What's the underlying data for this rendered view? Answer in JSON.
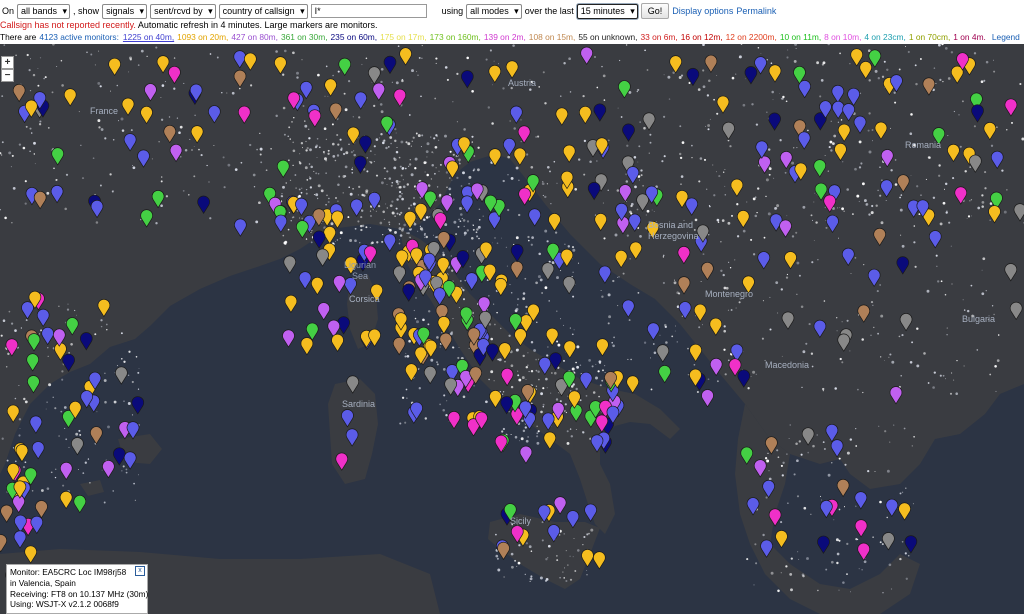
{
  "toolbar": {
    "on_label": "On",
    "bands_value": "all bands",
    "show_label": ", show",
    "signals_value": "signals",
    "sentrcvd_value": "sent/rcvd by",
    "country_value": "country of callsign",
    "callsign_value": "I*",
    "using_label": "using",
    "modes_value": "all modes",
    "over_label": "over the last",
    "time_value": "15 minutes",
    "go_label": "Go!",
    "display_options_label": "Display options",
    "permalink_label": "Permalink"
  },
  "warning": {
    "callsign_not_reported": "Callsign has not reported recently.",
    "refresh_text": "Automatic refresh in 4 minutes. Large markers are monitors."
  },
  "stats": {
    "prefix": "There are",
    "monitors_count": "4123 active monitors:",
    "bands": [
      {
        "text": "1225 on 40m,",
        "color": "#4040d0",
        "underline": true
      },
      {
        "text": "1093 on 20m,",
        "color": "#e2a400"
      },
      {
        "text": "427 on 80m,",
        "color": "#9a50d0"
      },
      {
        "text": "361 on 30m,",
        "color": "#3aa83a"
      },
      {
        "text": "235 on 60m,",
        "color": "#0a0a80"
      },
      {
        "text": "175 on 17m,",
        "color": "#e6e050"
      },
      {
        "text": "173 on 160m,",
        "color": "#70c020"
      },
      {
        "text": "139 on 2m,",
        "color": "#d03ad0"
      },
      {
        "text": "108 on 15m,",
        "color": "#c08850"
      },
      {
        "text": "55 on unknown,",
        "color": "#222222"
      },
      {
        "text": "33 on 6m,",
        "color": "#d02020"
      },
      {
        "text": "16 on 12m,",
        "color": "#c00000"
      },
      {
        "text": "12 on 2200m,",
        "color": "#e04020"
      },
      {
        "text": "10 on 11m,",
        "color": "#20c020"
      },
      {
        "text": "8 on 10m,",
        "color": "#e050e0"
      },
      {
        "text": "4 on 23cm,",
        "color": "#20a0b0"
      },
      {
        "text": "1 on 70cm,",
        "color": "#90a000"
      },
      {
        "text": "1 on 4m.",
        "color": "#a00050"
      }
    ],
    "legend_label": "Legend"
  },
  "map": {
    "zoom_in": "+",
    "zoom_out": "−",
    "places": [
      "France",
      "Austria",
      "Romania",
      "Ligurian Sea",
      "Bosnia and Herzegovina",
      "Montenegro",
      "Macedonia",
      "Bulgaria",
      "Sicily",
      "Sardinia",
      "Corsica"
    ]
  },
  "popup": {
    "line1": "Monitor: EA5CRC Loc IM98rj58",
    "line2": "in Valencia, Spain",
    "line3": "Receiving: FT8 on 10.137 MHz (30m)",
    "line4": "Using: WSJT-X v2.1.2 0068f9",
    "close_label": "x"
  },
  "colors": {
    "sea": "#2c3444",
    "land": "#3a3d42",
    "c40m": "#5b5ce8",
    "c20m": "#f5bd1f",
    "c80m": "#c060f0",
    "c30m": "#44d044",
    "c60m": "#0a0a7a",
    "c2m": "#f030c8",
    "c15m": "#b08058",
    "cunknown": "#888888"
  }
}
